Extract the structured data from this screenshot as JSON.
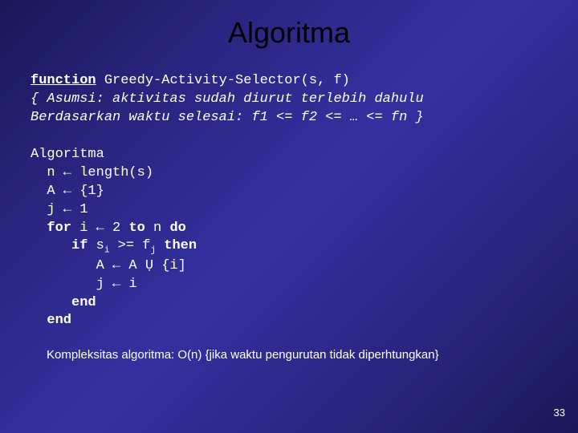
{
  "title": "Algoritma",
  "code": {
    "l1a": "function",
    "l1b": " Greedy-Activity-Selector(s, f)",
    "l2": "{ Asumsi: aktivitas sudah diurut terlebih dahulu",
    "l3": "Berdasarkan waktu selesai: f1 <= f2 <= … <= fn }",
    "l4": "Algoritma",
    "l5": "  n ← length(s)",
    "l6": "  A ← {1}",
    "l7": "  j ← 1",
    "l8a": "  ",
    "l8b": "for",
    "l8c": " i ← 2 ",
    "l8d": "to",
    "l8e": " n ",
    "l8f": "do",
    "l9a": "     ",
    "l9b": "if",
    "l9c": " s",
    "l9sub1": "i",
    "l9d": " >= f",
    "l9sub2": "j",
    "l9e": " ",
    "l9f": "then",
    "l10": "        A ← A Ụ {i]",
    "l11": "        j ← i",
    "l12a": "     ",
    "l12b": "end",
    "l13a": "  ",
    "l13b": "end"
  },
  "footer": "Kompleksitas algoritma: O(n)   {jika waktu pengurutan tidak diperhtungkan}",
  "pagenum": "33"
}
